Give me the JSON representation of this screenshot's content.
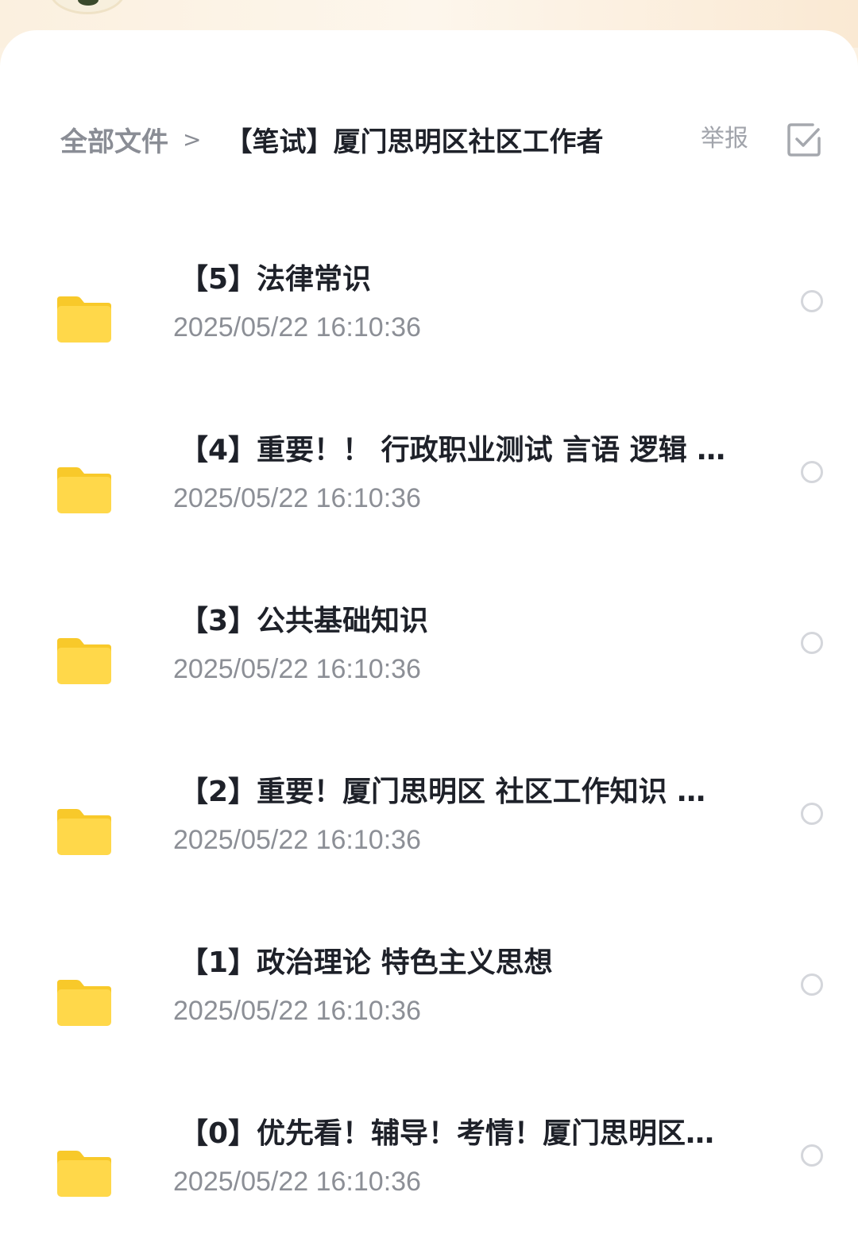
{
  "breadcrumb": {
    "root": "全部文件",
    "separator": ">",
    "current": "【笔试】厦门思明区社区工作者"
  },
  "actions": {
    "report_label": "举报",
    "select_icon": "checkbox-check-icon"
  },
  "colors": {
    "folder": "#ffd84a",
    "folder_tab": "#f8c92a",
    "title_text": "#1e2129",
    "secondary_text": "#8c8f96"
  },
  "files": [
    {
      "name": "【5】法律常识",
      "date": "2025/05/22 16:10:36",
      "icon": "folder-icon"
    },
    {
      "name": "【4】重要！！ 行政职业测试 言语 逻辑 …",
      "date": "2025/05/22 16:10:36",
      "icon": "folder-icon"
    },
    {
      "name": "【3】公共基础知识",
      "date": "2025/05/22 16:10:36",
      "icon": "folder-icon"
    },
    {
      "name": "【2】重要！厦门思明区 社区工作知识 …",
      "date": "2025/05/22 16:10:36",
      "icon": "folder-icon"
    },
    {
      "name": "【1】政治理论 特色主义思想",
      "date": "2025/05/22 16:10:36",
      "icon": "folder-icon"
    },
    {
      "name": "【0】优先看！辅导！考情！厦门思明区…",
      "date": "2025/05/22 16:10:36",
      "icon": "folder-icon"
    }
  ]
}
